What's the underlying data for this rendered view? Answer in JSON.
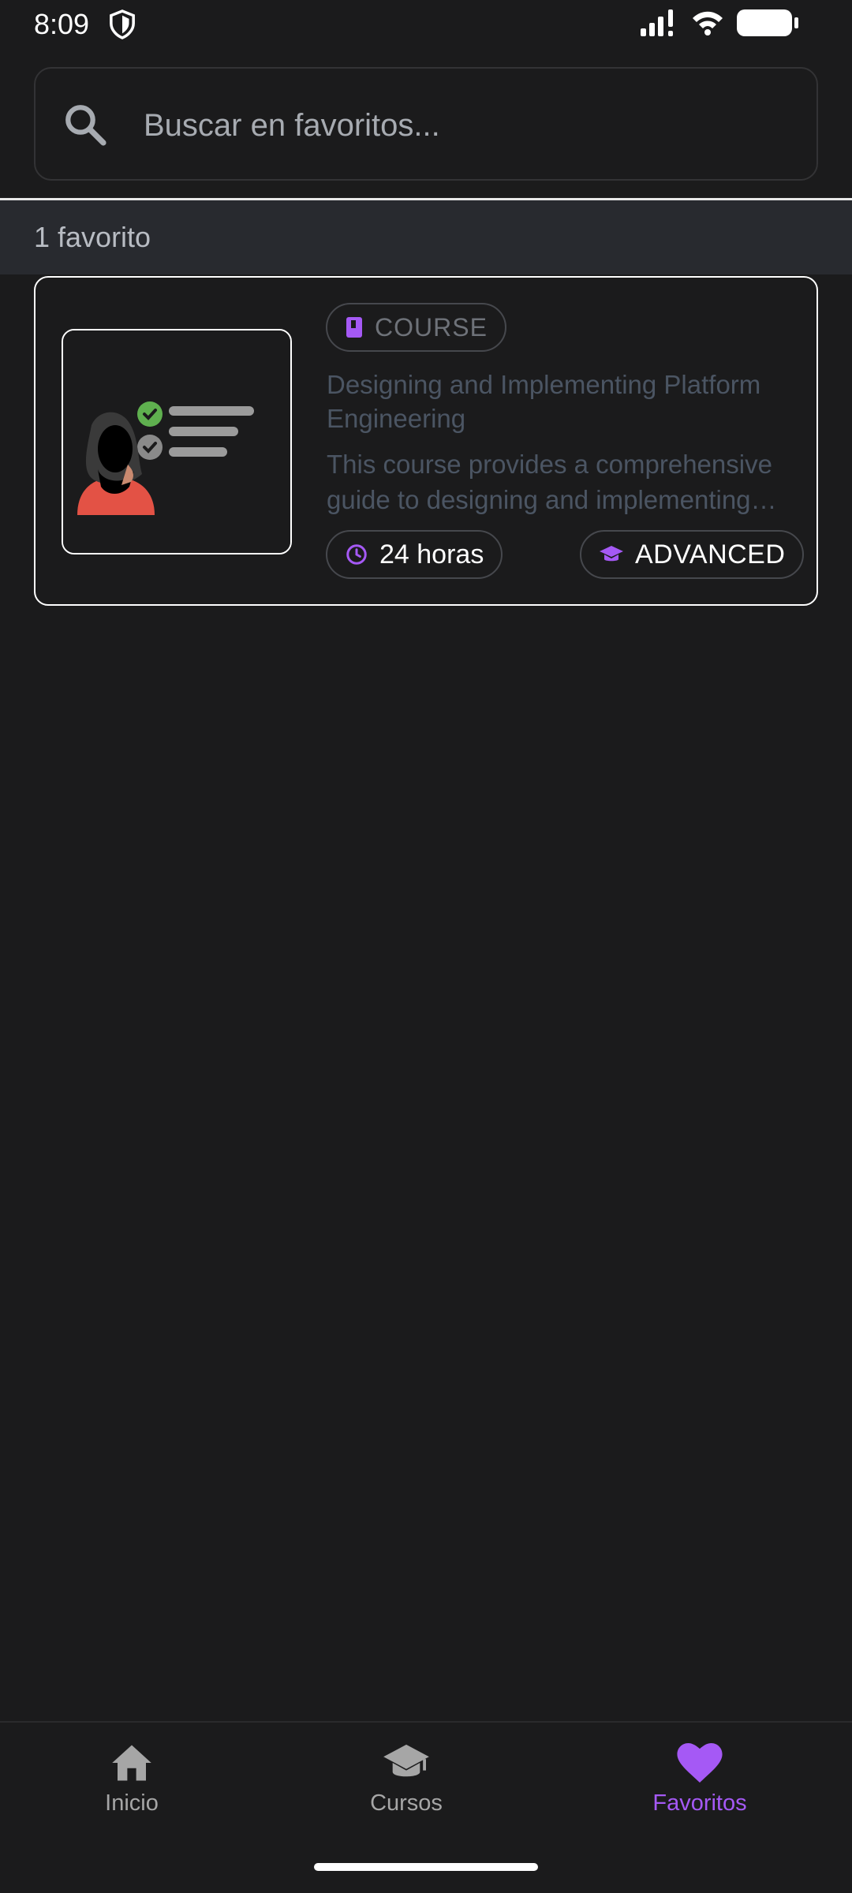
{
  "status": {
    "time": "8:09"
  },
  "search": {
    "placeholder": "Buscar en favoritos..."
  },
  "results": {
    "count_label": "1 favorito"
  },
  "favorites": [
    {
      "type_label": "COURSE",
      "title": "Designing and Implementing Platform Engineering",
      "description": "This course provides a comprehensive guide to designing and implementing platform engineering practices.",
      "duration": "24 horas",
      "level": "ADVANCED"
    }
  ],
  "nav": {
    "items": [
      {
        "label": "Inicio",
        "icon": "home-icon"
      },
      {
        "label": "Cursos",
        "icon": "graduation-cap-icon"
      },
      {
        "label": "Favoritos",
        "icon": "heart-icon",
        "active": true
      }
    ]
  },
  "colors": {
    "accent": "#a559f5",
    "background": "#1b1b1c",
    "header_band": "#282a2f",
    "muted_text": "#4b5563"
  }
}
